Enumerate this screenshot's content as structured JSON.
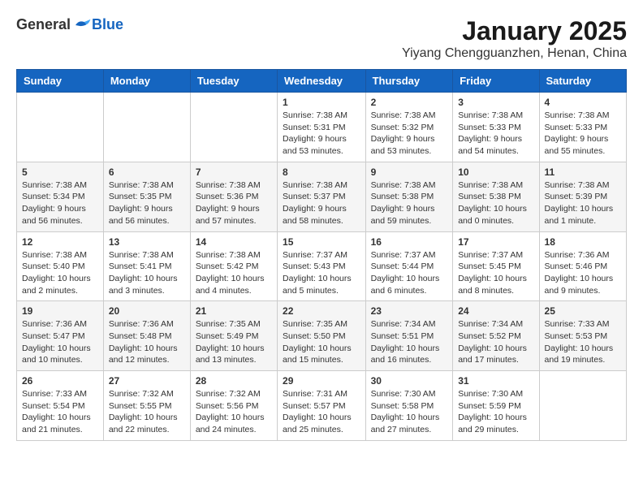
{
  "logo": {
    "general": "General",
    "blue": "Blue"
  },
  "header": {
    "month_title": "January 2025",
    "location": "Yiyang Chengguanzhen, Henan, China"
  },
  "days_of_week": [
    "Sunday",
    "Monday",
    "Tuesday",
    "Wednesday",
    "Thursday",
    "Friday",
    "Saturday"
  ],
  "weeks": [
    [
      {
        "day": "",
        "info": ""
      },
      {
        "day": "",
        "info": ""
      },
      {
        "day": "",
        "info": ""
      },
      {
        "day": "1",
        "info": "Sunrise: 7:38 AM\nSunset: 5:31 PM\nDaylight: 9 hours and 53 minutes."
      },
      {
        "day": "2",
        "info": "Sunrise: 7:38 AM\nSunset: 5:32 PM\nDaylight: 9 hours and 53 minutes."
      },
      {
        "day": "3",
        "info": "Sunrise: 7:38 AM\nSunset: 5:33 PM\nDaylight: 9 hours and 54 minutes."
      },
      {
        "day": "4",
        "info": "Sunrise: 7:38 AM\nSunset: 5:33 PM\nDaylight: 9 hours and 55 minutes."
      }
    ],
    [
      {
        "day": "5",
        "info": "Sunrise: 7:38 AM\nSunset: 5:34 PM\nDaylight: 9 hours and 56 minutes."
      },
      {
        "day": "6",
        "info": "Sunrise: 7:38 AM\nSunset: 5:35 PM\nDaylight: 9 hours and 56 minutes."
      },
      {
        "day": "7",
        "info": "Sunrise: 7:38 AM\nSunset: 5:36 PM\nDaylight: 9 hours and 57 minutes."
      },
      {
        "day": "8",
        "info": "Sunrise: 7:38 AM\nSunset: 5:37 PM\nDaylight: 9 hours and 58 minutes."
      },
      {
        "day": "9",
        "info": "Sunrise: 7:38 AM\nSunset: 5:38 PM\nDaylight: 9 hours and 59 minutes."
      },
      {
        "day": "10",
        "info": "Sunrise: 7:38 AM\nSunset: 5:38 PM\nDaylight: 10 hours and 0 minutes."
      },
      {
        "day": "11",
        "info": "Sunrise: 7:38 AM\nSunset: 5:39 PM\nDaylight: 10 hours and 1 minute."
      }
    ],
    [
      {
        "day": "12",
        "info": "Sunrise: 7:38 AM\nSunset: 5:40 PM\nDaylight: 10 hours and 2 minutes."
      },
      {
        "day": "13",
        "info": "Sunrise: 7:38 AM\nSunset: 5:41 PM\nDaylight: 10 hours and 3 minutes."
      },
      {
        "day": "14",
        "info": "Sunrise: 7:38 AM\nSunset: 5:42 PM\nDaylight: 10 hours and 4 minutes."
      },
      {
        "day": "15",
        "info": "Sunrise: 7:37 AM\nSunset: 5:43 PM\nDaylight: 10 hours and 5 minutes."
      },
      {
        "day": "16",
        "info": "Sunrise: 7:37 AM\nSunset: 5:44 PM\nDaylight: 10 hours and 6 minutes."
      },
      {
        "day": "17",
        "info": "Sunrise: 7:37 AM\nSunset: 5:45 PM\nDaylight: 10 hours and 8 minutes."
      },
      {
        "day": "18",
        "info": "Sunrise: 7:36 AM\nSunset: 5:46 PM\nDaylight: 10 hours and 9 minutes."
      }
    ],
    [
      {
        "day": "19",
        "info": "Sunrise: 7:36 AM\nSunset: 5:47 PM\nDaylight: 10 hours and 10 minutes."
      },
      {
        "day": "20",
        "info": "Sunrise: 7:36 AM\nSunset: 5:48 PM\nDaylight: 10 hours and 12 minutes."
      },
      {
        "day": "21",
        "info": "Sunrise: 7:35 AM\nSunset: 5:49 PM\nDaylight: 10 hours and 13 minutes."
      },
      {
        "day": "22",
        "info": "Sunrise: 7:35 AM\nSunset: 5:50 PM\nDaylight: 10 hours and 15 minutes."
      },
      {
        "day": "23",
        "info": "Sunrise: 7:34 AM\nSunset: 5:51 PM\nDaylight: 10 hours and 16 minutes."
      },
      {
        "day": "24",
        "info": "Sunrise: 7:34 AM\nSunset: 5:52 PM\nDaylight: 10 hours and 17 minutes."
      },
      {
        "day": "25",
        "info": "Sunrise: 7:33 AM\nSunset: 5:53 PM\nDaylight: 10 hours and 19 minutes."
      }
    ],
    [
      {
        "day": "26",
        "info": "Sunrise: 7:33 AM\nSunset: 5:54 PM\nDaylight: 10 hours and 21 minutes."
      },
      {
        "day": "27",
        "info": "Sunrise: 7:32 AM\nSunset: 5:55 PM\nDaylight: 10 hours and 22 minutes."
      },
      {
        "day": "28",
        "info": "Sunrise: 7:32 AM\nSunset: 5:56 PM\nDaylight: 10 hours and 24 minutes."
      },
      {
        "day": "29",
        "info": "Sunrise: 7:31 AM\nSunset: 5:57 PM\nDaylight: 10 hours and 25 minutes."
      },
      {
        "day": "30",
        "info": "Sunrise: 7:30 AM\nSunset: 5:58 PM\nDaylight: 10 hours and 27 minutes."
      },
      {
        "day": "31",
        "info": "Sunrise: 7:30 AM\nSunset: 5:59 PM\nDaylight: 10 hours and 29 minutes."
      },
      {
        "day": "",
        "info": ""
      }
    ]
  ]
}
